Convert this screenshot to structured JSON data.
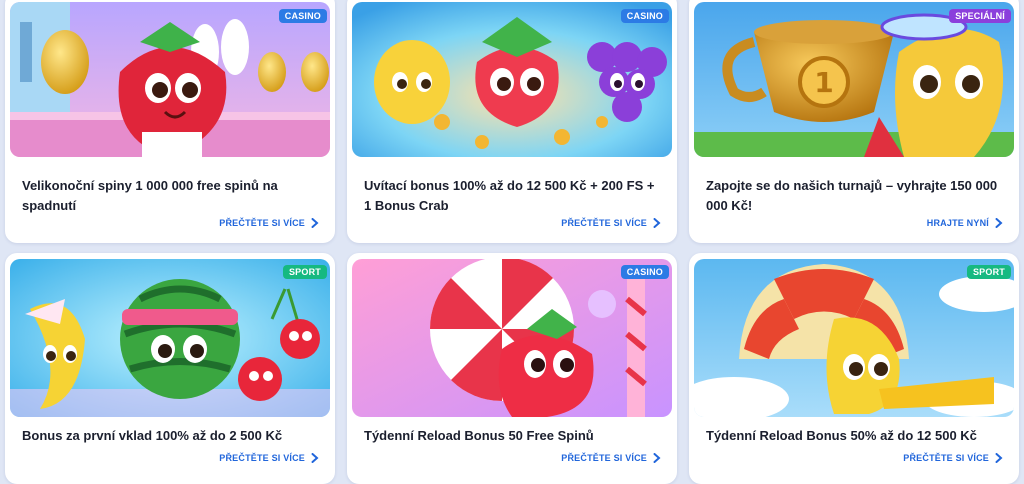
{
  "cards": [
    {
      "badge": "CASINO",
      "title": "Velikonoční spiny 1 000 000 free spinů na spadnutí",
      "cta": "PŘEČTĚTE SI VÍCE"
    },
    {
      "badge": "CASINO",
      "title": "Uvítací bonus 100% až do 12 500 Kč + 200 FS + 1 Bonus Crab",
      "cta": "PŘEČTĚTE SI VÍCE"
    },
    {
      "badge": "SPECIÁLNÍ",
      "title": "Zapojte se do našich turnajů – vyhrajte 150 000 000 Kč!",
      "cta": "HRAJTE NYNÍ"
    },
    {
      "badge": "SPORT",
      "title": "Bonus za první vklad 100% až do 2 500 Kč",
      "cta": "PŘEČTĚTE SI VÍCE"
    },
    {
      "badge": "CASINO",
      "title": "Týdenní Reload Bonus 50 Free Spinů",
      "cta": "PŘEČTĚTE SI VÍCE"
    },
    {
      "badge": "SPORT",
      "title": "Týdenní Reload Bonus 50% až do 12 500 Kč",
      "cta": "PŘEČTĚTE SI VÍCE"
    }
  ],
  "icons": {
    "cta_chevron": "chevron-right-icon"
  },
  "colors": {
    "casino": "#2c7be5",
    "special": "#8b3fdc",
    "sport": "#16b981",
    "cta": "#2166db"
  }
}
